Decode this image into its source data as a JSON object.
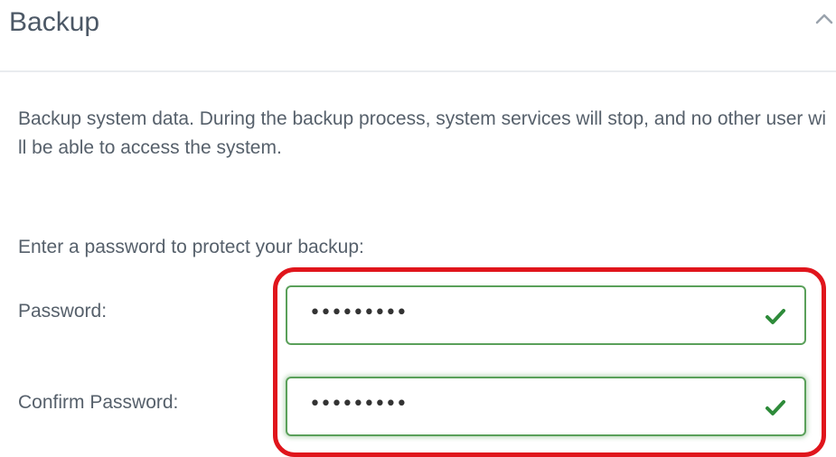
{
  "panel": {
    "title": "Backup",
    "collapse_icon": "chevron-up-icon"
  },
  "description": "Backup system data. During the backup process, system services will stop, and no other user will be able to access the system.",
  "form": {
    "prompt": "Enter a password to protect your backup:",
    "password": {
      "label": "Password:",
      "value": "•••••••••",
      "status_icon": "check-icon"
    },
    "confirm_password": {
      "label": "Confirm Password:",
      "value": "•••••••••",
      "status_icon": "check-icon"
    }
  },
  "colors": {
    "valid": "#2e8b3a",
    "highlight": "#e0151c"
  }
}
